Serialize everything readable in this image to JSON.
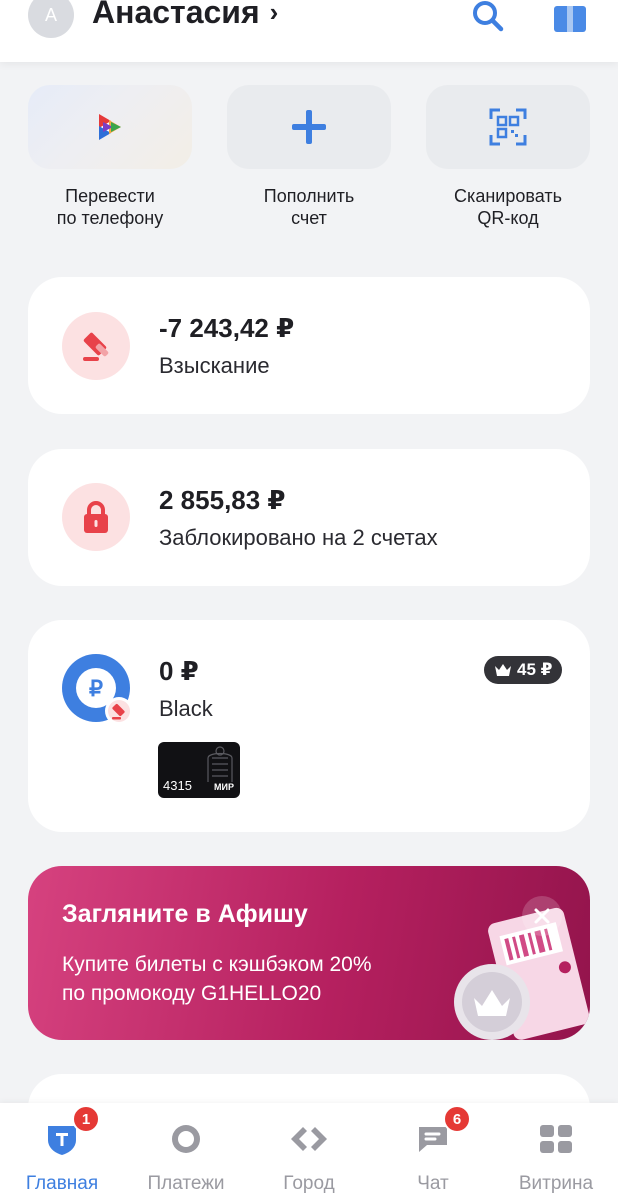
{
  "header": {
    "avatar_letter": "А",
    "user_name": "Анастасия",
    "chevron": "›",
    "search_icon": "search-icon",
    "gift_icon": "gift-icon"
  },
  "quick_actions": [
    {
      "label": "Перевести\nпо телефону",
      "icon": "transfer-by-phone-icon"
    },
    {
      "label": "Пополнить\nсчет",
      "icon": "plus-icon"
    },
    {
      "label": "Сканировать\nQR-код",
      "icon": "qr-scan-icon"
    }
  ],
  "cards": {
    "collection": {
      "amount": "-7 243,42 ₽",
      "label": "Взыскание",
      "icon": "gavel-icon"
    },
    "blocked": {
      "amount": "2 855,83 ₽",
      "label": "Заблокировано на 2 счетах",
      "icon": "lock-icon"
    },
    "account": {
      "amount": "0 ₽",
      "label": "Black",
      "cashback": "45 ₽",
      "card_number": "4315",
      "card_network": "МИР",
      "icon": "ruble-icon"
    }
  },
  "promo": {
    "title": "Загляните в Афишу",
    "text": "Купите билеты с кэшбэком 20%\nпо промокоду G1HELLO20"
  },
  "tabs": [
    {
      "label": "Главная",
      "icon": "home-shield-icon",
      "badge": "1",
      "active": true
    },
    {
      "label": "Платежи",
      "icon": "payments-icon"
    },
    {
      "label": "Город",
      "icon": "city-icon"
    },
    {
      "label": "Чат",
      "icon": "chat-icon",
      "badge": "6"
    },
    {
      "label": "Витрина",
      "icon": "showcase-icon"
    }
  ],
  "colors": {
    "accent": "#3e7fe0",
    "danger_bg": "#fce1e2",
    "danger": "#e8424a",
    "promo": "#c42d6c",
    "badge": "#e53935"
  }
}
